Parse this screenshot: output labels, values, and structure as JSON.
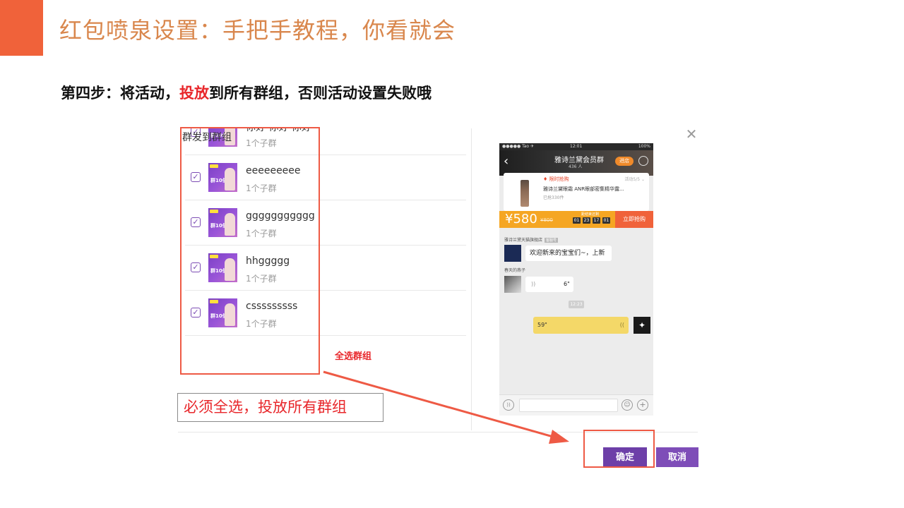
{
  "slide": {
    "title": "红包喷泉设置：手把手教程，你看就会",
    "step_prefix": "第四步：将活动，",
    "step_highlight": "投放",
    "step_suffix": "到所有群组，否则活动设置失败哦",
    "accent_color": "#f0623a"
  },
  "dialog": {
    "title": "群发到群组",
    "close_icon": "close-icon",
    "groups": [
      {
        "name": "你好 你好 你好",
        "sub": "1个子群",
        "checked": true
      },
      {
        "name": "eeeeeeeee",
        "sub": "1个子群",
        "checked": true
      },
      {
        "name": "ggggggggggg",
        "sub": "1个子群",
        "checked": true
      },
      {
        "name": "hhggggg",
        "sub": "1个子群",
        "checked": true
      },
      {
        "name": "csssssssss",
        "sub": "1个子群",
        "checked": true
      }
    ],
    "thumb_text": "群10倍",
    "confirm_label": "确定",
    "cancel_label": "取消",
    "brand_color": "#6d3fa8"
  },
  "annotations": {
    "select_all": "全选群组",
    "callout": "必须全选，投放所有群组"
  },
  "phone": {
    "status_left": "●●●●● Tao ✈",
    "status_time": "12:01",
    "status_right": "100%",
    "group_name": "雅诗兰黛会员群",
    "members": "436 人",
    "enter_label": "进店",
    "flash_sale": "♦ 限时抢购",
    "flash_right": "活动5/5 ⌄",
    "product_name": "雅诗兰黛眼霜 ANR眼部密集精华露...",
    "sold": "已抢330件",
    "price": "¥580",
    "old_price": "¥800",
    "ends_label": "距结束还剩",
    "timer": [
      "01",
      "23",
      "17",
      "01"
    ],
    "buy_label": "立即抢购",
    "shop_name": "雅诗兰黛天猫旗舰店",
    "shop_tag": "客服号",
    "welcome_msg": "欢迎新来的宝宝们~，上新",
    "user2": "春天的燕子",
    "voice1": "6\"",
    "time_chip": "12:23",
    "voice2": "59\""
  }
}
